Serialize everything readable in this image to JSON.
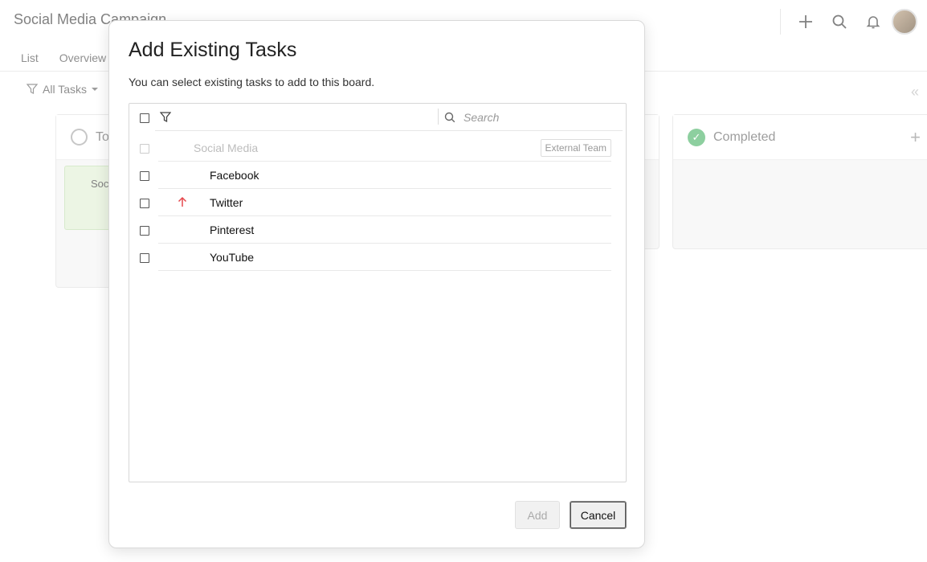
{
  "app": {
    "title": "Social Media Campaign",
    "tabs": [
      "List",
      "Overview"
    ],
    "filter_label": "All Tasks"
  },
  "board": {
    "columns": [
      {
        "title": "To",
        "card_label": "Soc"
      },
      {
        "title": ""
      },
      {
        "title": "Completed"
      }
    ]
  },
  "dialog": {
    "title": "Add Existing Tasks",
    "subtitle": "You can select existing tasks to add to this board.",
    "search_placeholder": "Search",
    "group": {
      "name": "Social Media",
      "tag": "External Team"
    },
    "tasks": [
      {
        "name": "Facebook",
        "priority": false
      },
      {
        "name": "Twitter",
        "priority": true
      },
      {
        "name": "Pinterest",
        "priority": false
      },
      {
        "name": "YouTube",
        "priority": false
      }
    ],
    "add_label": "Add",
    "cancel_label": "Cancel"
  },
  "icons": {
    "plus": "plus-icon",
    "search": "search-icon",
    "bell": "bell-icon",
    "filter": "filter-icon",
    "priority": "arrow-up-icon",
    "check": "check-icon"
  },
  "colors": {
    "priority_high": "#e5484d",
    "completed": "#74c58a",
    "card_bg": "#e8f3df"
  }
}
